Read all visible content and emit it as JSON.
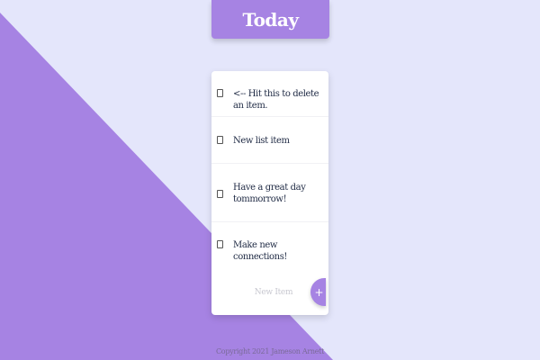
{
  "colors": {
    "background": "#e4e6fb",
    "accent": "#a683e3",
    "card": "#ffffff",
    "text": "#1f2a44"
  },
  "header": {
    "title": "Today"
  },
  "list": {
    "items": [
      {
        "label": "<-- Hit this to delete an item.",
        "checked": false
      },
      {
        "label": "New list item",
        "checked": false
      },
      {
        "label": "Have a great day tommorrow!",
        "checked": false
      },
      {
        "label": "Make new connections!",
        "checked": false
      }
    ]
  },
  "new_item": {
    "placeholder": "New Item",
    "value": "",
    "add_icon": "plus-icon",
    "add_symbol": "+"
  },
  "footer": {
    "text": "Copyright 2021 Jameson Arnett"
  }
}
